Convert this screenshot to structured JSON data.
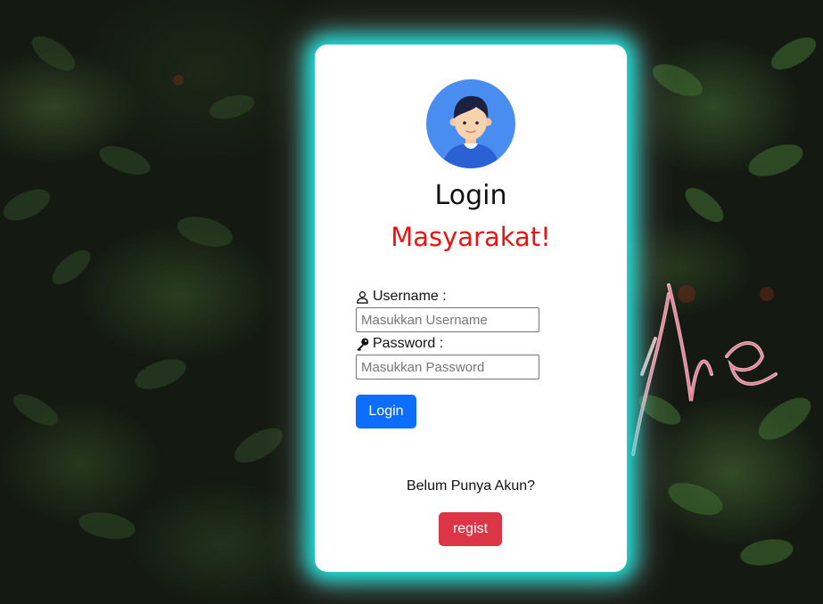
{
  "background": {
    "neon_text": "the",
    "neon_color": "#ff6f8a"
  },
  "card": {
    "avatar_icon": "user-avatar-icon",
    "title": "Login",
    "subtitle": "Masyarakat!",
    "subtitle_color": "#ee1111",
    "glow_color": "#1ee6e0"
  },
  "form": {
    "username": {
      "icon": "user-icon",
      "label": "Username :",
      "placeholder": "Masukkan Username",
      "value": ""
    },
    "password": {
      "icon": "key-icon",
      "label": "Password :",
      "placeholder": "Masukkan Password",
      "value": ""
    },
    "login_button": "Login",
    "login_color": "#0d6efd"
  },
  "footer": {
    "prompt": "Belum Punya Akun?",
    "regist_button": "regist",
    "regist_color": "#dc3545"
  }
}
